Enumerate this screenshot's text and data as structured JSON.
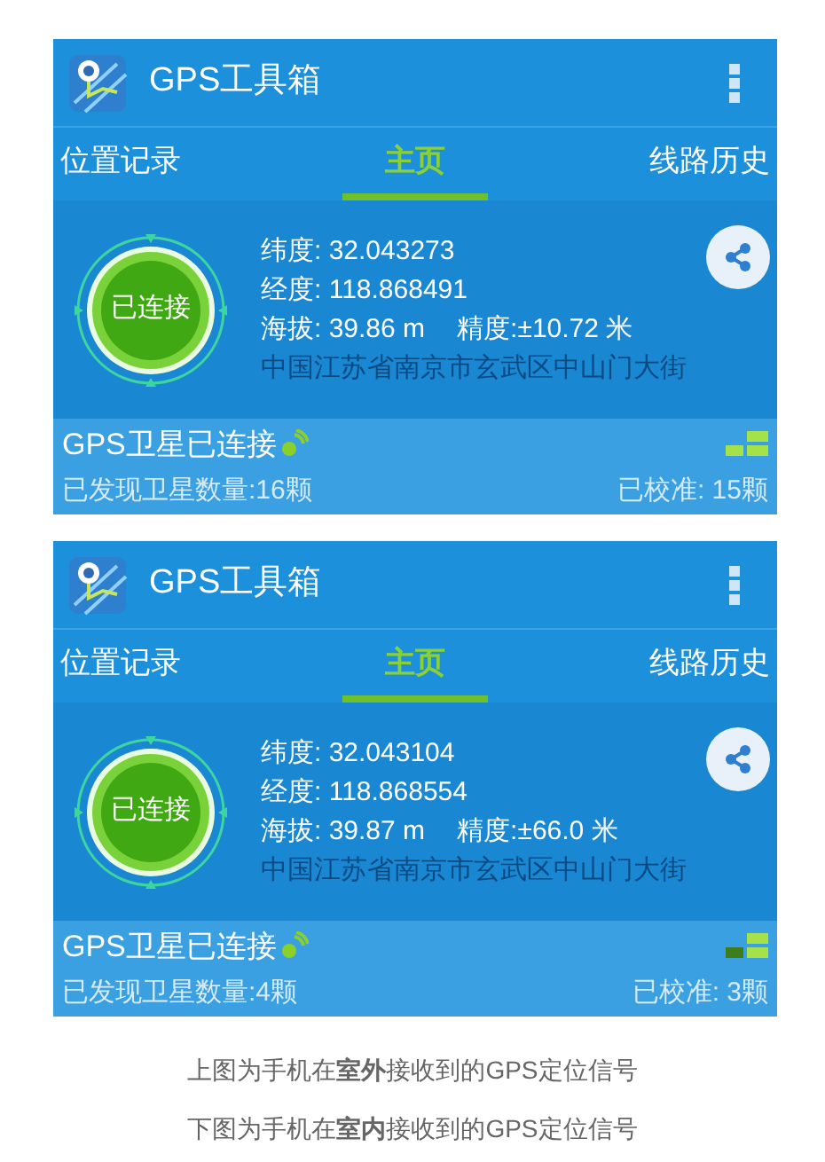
{
  "screens": [
    {
      "app_title": "GPS工具箱",
      "tabs": [
        {
          "label": "位置记录",
          "selected": false
        },
        {
          "label": "主页",
          "selected": true
        },
        {
          "label": "线路历史",
          "selected": false
        }
      ],
      "status_badge": "已连接",
      "latitude": "纬度: 32.043273",
      "longitude": "经度: 118.868491",
      "altitude": "海拔: 39.86 m",
      "accuracy": "精度:±10.72 米",
      "address": "中国江苏省南京市玄武区中山门大街",
      "satellite_status": "GPS卫星已连接",
      "found": "已发现卫星数量:16颗",
      "calibrated": "已校准: 15颗",
      "strong_signal": true
    },
    {
      "app_title": "GPS工具箱",
      "tabs": [
        {
          "label": "位置记录",
          "selected": false
        },
        {
          "label": "主页",
          "selected": true
        },
        {
          "label": "线路历史",
          "selected": false
        }
      ],
      "status_badge": "已连接",
      "latitude": "纬度: 32.043104",
      "longitude": "经度: 118.868554",
      "altitude": "海拔: 39.87 m",
      "accuracy": "精度:±66.0 米",
      "address": "中国江苏省南京市玄武区中山门大街",
      "satellite_status": "GPS卫星已连接",
      "found": "已发现卫星数量:4颗",
      "calibrated": "已校准: 3颗",
      "strong_signal": false
    }
  ],
  "captions": [
    "上图为手机在**室外**接收到的GPS定位信号",
    "下图为手机在**室内**接收到的GPS定位信号"
  ]
}
